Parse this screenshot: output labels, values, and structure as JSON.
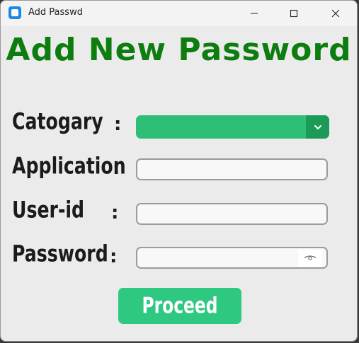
{
  "window": {
    "title": "Add Passwd"
  },
  "heading": "Add New Password",
  "form": {
    "category": {
      "label": "Catogary",
      "colon": ":",
      "selected_value": ""
    },
    "application": {
      "label": "Application",
      "colon": ":",
      "value": "",
      "placeholder": ""
    },
    "user_id": {
      "label": "User-id",
      "colon": ":",
      "value": "",
      "placeholder": ""
    },
    "password": {
      "label": "Password",
      "colon": ":",
      "value": "",
      "placeholder": ""
    },
    "proceed_label": "Proceed"
  },
  "icons": {
    "app": "app-icon",
    "minimize": "minimize-icon",
    "maximize": "maximize-icon",
    "close": "close-icon",
    "dropdown": "chevron-down-icon",
    "show_password": "eye-icon"
  },
  "colors": {
    "heading": "#0e7d10",
    "dropdown": "#2ebf77",
    "dropdown_arrow": "#1c9a58",
    "button": "#2ec880"
  }
}
